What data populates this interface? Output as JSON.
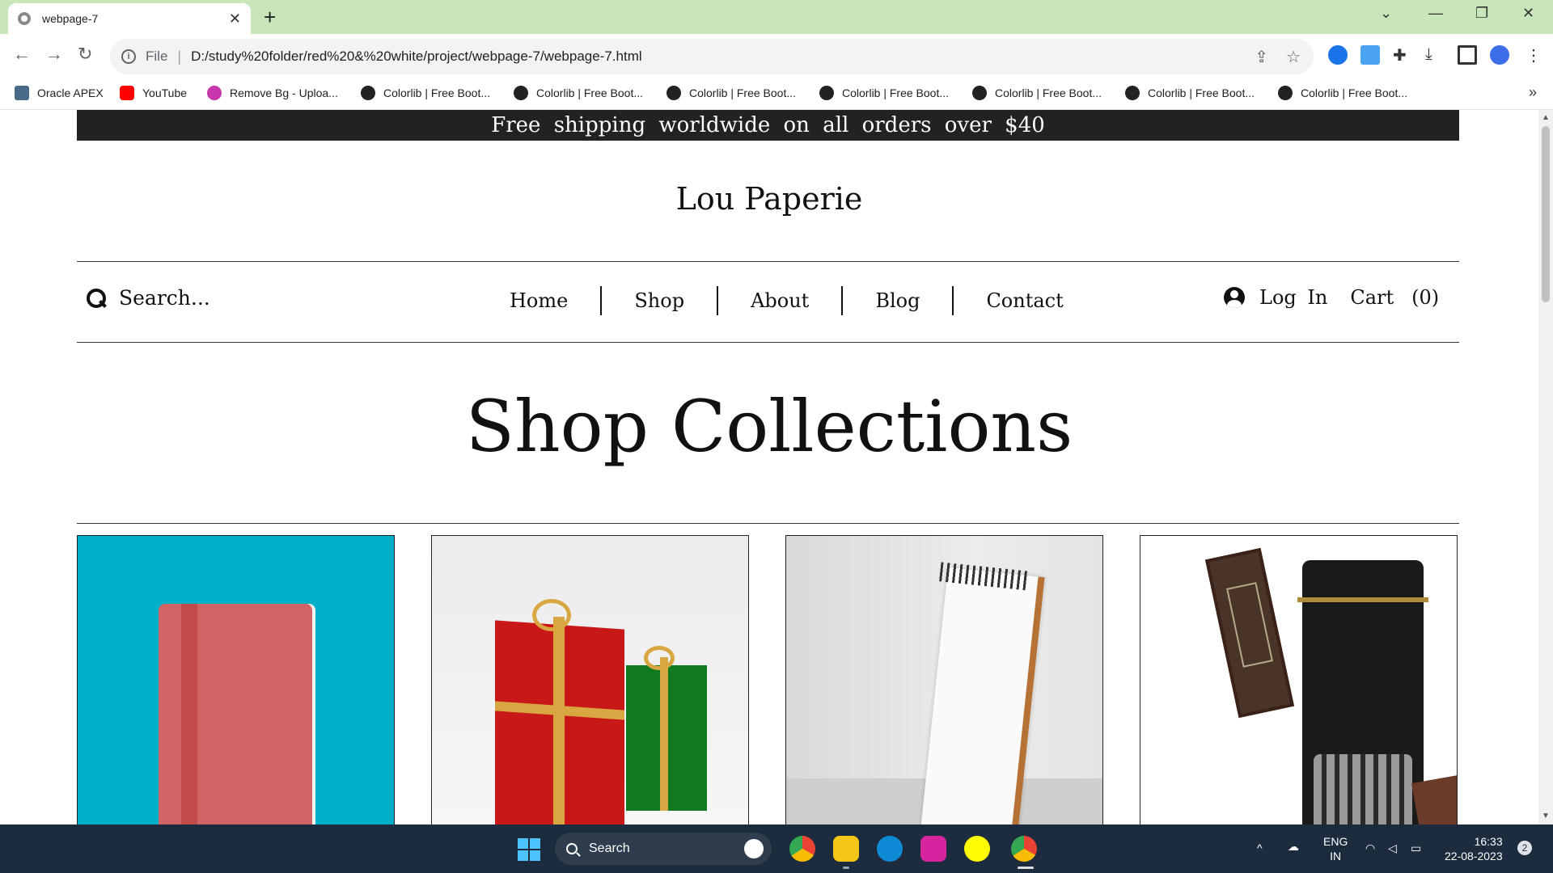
{
  "browser": {
    "tab_title": "webpage-7",
    "tab_close": "✕",
    "new_tab": "+",
    "file_label": "File",
    "url": "D:/study%20folder/red%20&%20white/project/webpage-7/webpage-7.html",
    "bookmarks": [
      {
        "label": "Oracle APEX",
        "color": "#4a6a8a"
      },
      {
        "label": "YouTube",
        "color": "#ff0000"
      },
      {
        "label": "Remove Bg - Uploa...",
        "color": "#c837ab"
      },
      {
        "label": "Colorlib | Free Boot...",
        "color": "#222222"
      },
      {
        "label": "Colorlib | Free Boot...",
        "color": "#222222"
      },
      {
        "label": "Colorlib | Free Boot...",
        "color": "#222222"
      },
      {
        "label": "Colorlib | Free Boot...",
        "color": "#222222"
      },
      {
        "label": "Colorlib | Free Boot...",
        "color": "#222222"
      },
      {
        "label": "Colorlib | Free Boot...",
        "color": "#222222"
      },
      {
        "label": "Colorlib | Free Boot...",
        "color": "#222222"
      }
    ]
  },
  "page": {
    "promo": "Free shipping worldwide on all orders over $40",
    "brand": "Lou Paperie",
    "search_placeholder": "Search...",
    "menu": [
      "Home",
      "Shop",
      "About",
      "Blog",
      "Contact"
    ],
    "login": "Log In",
    "cart": "Cart",
    "cart_count": "(0)",
    "section_title": "Shop Collections"
  },
  "taskbar": {
    "search_label": "Search",
    "lang": "ENG",
    "region": "IN",
    "time": "16:33",
    "date": "22-08-2023",
    "notifications": "2"
  },
  "colors": {
    "promo_bg": "#222222",
    "tab_strip": "#c8e6b9",
    "card1_bg": "#00b0c8",
    "taskbar_bg": "#1c2b3d"
  }
}
